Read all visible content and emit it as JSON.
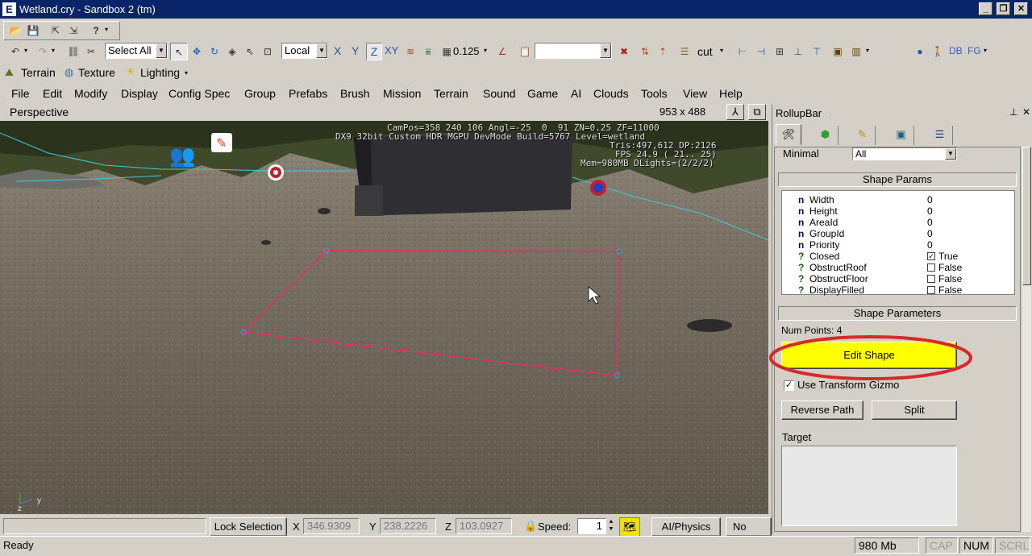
{
  "window": {
    "title": "Wetland.cry - Sandbox 2 (tm)",
    "icon": "E"
  },
  "toolbar1": {
    "help_icon": "?"
  },
  "toolbar2": {
    "select_all": "Select All",
    "coord_system": "Local",
    "axis_x": "X",
    "axis_y": "Y",
    "axis_z": "Z",
    "axis_xy": "XY",
    "grid_size": "0.125",
    "layer_label": "cut",
    "db_label": "DB",
    "fg_label": "FG"
  },
  "toolbar3": {
    "terrain": "Terrain",
    "texture": "Texture",
    "lighting": "Lighting"
  },
  "menu": [
    "File",
    "Edit",
    "Modify",
    "Display",
    "Config Spec",
    "Group",
    "Prefabs",
    "Brush",
    "Mission",
    "Terrain",
    "Sound",
    "Game",
    "AI",
    "Clouds",
    "Tools",
    "View",
    "Help"
  ],
  "viewport": {
    "name": "Perspective",
    "size": "953 x 488",
    "overlay_line1": "CamPos=358 240 106 Angl=-25  0  91 ZN=0.25 ZF=11000",
    "overlay_line2": "DX9 32bit Custom HDR MGPU DevMode Build=5767 Level=wetland",
    "overlay_line3": "Tris:497,612 DP:2126",
    "overlay_line4": "FPS 24.9 ( 21.. 25)",
    "overlay_line5": "Mem=980MB DLights=(2/2/2)",
    "axis_y": "y",
    "axis_z": "z"
  },
  "rollup": {
    "title": "RollupBar",
    "minimal_label": "Minimal",
    "minimal_value": "All",
    "shape_params_title": "Shape Params",
    "params": [
      {
        "type": "n",
        "name": "Width",
        "value": "0"
      },
      {
        "type": "n",
        "name": "Height",
        "value": "0"
      },
      {
        "type": "n",
        "name": "AreaId",
        "value": "0"
      },
      {
        "type": "n",
        "name": "GroupId",
        "value": "0"
      },
      {
        "type": "n",
        "name": "Priority",
        "value": "0"
      },
      {
        "type": "?",
        "name": "Closed",
        "value": "True",
        "checked": true
      },
      {
        "type": "?",
        "name": "ObstructRoof",
        "value": "False",
        "checked": false
      },
      {
        "type": "?",
        "name": "ObstructFloor",
        "value": "False",
        "checked": false
      },
      {
        "type": "?",
        "name": "DisplayFilled",
        "value": "False",
        "checked": false
      }
    ],
    "shape_parameters_title": "Shape Parameters",
    "num_points": "Num Points: 4",
    "edit_shape": "Edit Shape",
    "use_transform_gizmo": "Use Transform Gizmo",
    "reverse_path": "Reverse Path",
    "split": "Split",
    "target_label": "Target"
  },
  "bottom": {
    "lock_selection": "Lock Selection",
    "x_label": "X",
    "x_value": "346.9309",
    "y_label": "Y",
    "y_value": "238.2226",
    "z_label": "Z",
    "z_value": "103.0927",
    "speed_label": "Speed:",
    "speed_value": "1",
    "ai_physics": "AI/Physics",
    "no_sync": "No Sync"
  },
  "status": {
    "ready": "Ready",
    "memory": "980 Mb",
    "cap": "CAP",
    "num": "NUM",
    "scrl": "SCRL"
  },
  "colors": {
    "titlebar": "#0a246a",
    "edit_shape_bg": "#ffff00",
    "highlight_ring": "#d42a2a",
    "shape_outline": "#e0306a"
  }
}
